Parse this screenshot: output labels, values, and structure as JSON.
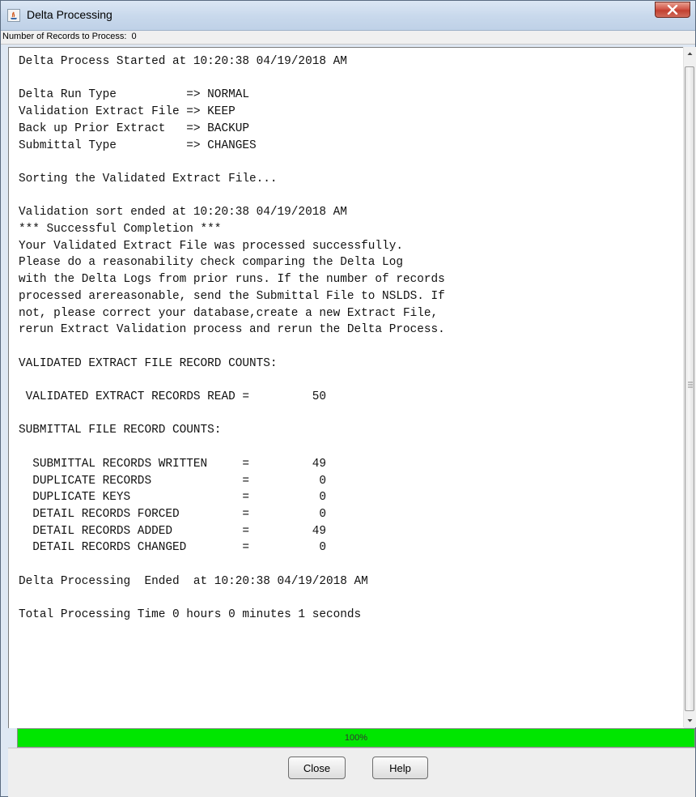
{
  "window": {
    "title": "Delta Processing",
    "icon": "java-app-icon",
    "close_icon": "close-icon"
  },
  "records": {
    "label": "Number of Records to Process:",
    "value": "0"
  },
  "log": {
    "lines": [
      "Delta Process Started at 10:20:38 04/19/2018 AM",
      "",
      "Delta Run Type          => NORMAL",
      "Validation Extract File => KEEP",
      "Back up Prior Extract   => BACKUP",
      "Submittal Type          => CHANGES",
      "",
      "Sorting the Validated Extract File...",
      "",
      "Validation sort ended at 10:20:38 04/19/2018 AM",
      "*** Successful Completion ***",
      "Your Validated Extract File was processed successfully.",
      "Please do a reasonability check comparing the Delta Log",
      "with the Delta Logs from prior runs. If the number of records",
      "processed arereasonable, send the Submittal File to NSLDS. If",
      "not, please correct your database,create a new Extract File,",
      "rerun Extract Validation process and rerun the Delta Process.",
      "",
      "VALIDATED EXTRACT FILE RECORD COUNTS:",
      "",
      " VALIDATED EXTRACT RECORDS READ =         50",
      "",
      "SUBMITTAL FILE RECORD COUNTS:",
      "",
      "  SUBMITTAL RECORDS WRITTEN     =         49",
      "  DUPLICATE RECORDS             =          0",
      "  DUPLICATE KEYS                =          0",
      "  DETAIL RECORDS FORCED         =          0",
      "  DETAIL RECORDS ADDED          =         49",
      "  DETAIL RECORDS CHANGED        =          0",
      "",
      "Delta Processing  Ended  at 10:20:38 04/19/2018 AM",
      "",
      "Total Processing Time 0 hours 0 minutes 1 seconds"
    ]
  },
  "progress": {
    "percent": 100,
    "label": "100%",
    "color": "#00e600"
  },
  "buttons": {
    "close_label": "Close",
    "help_label": "Help"
  },
  "scrollbar": {
    "up_icon": "arrow-up-icon",
    "down_icon": "arrow-down-icon"
  }
}
